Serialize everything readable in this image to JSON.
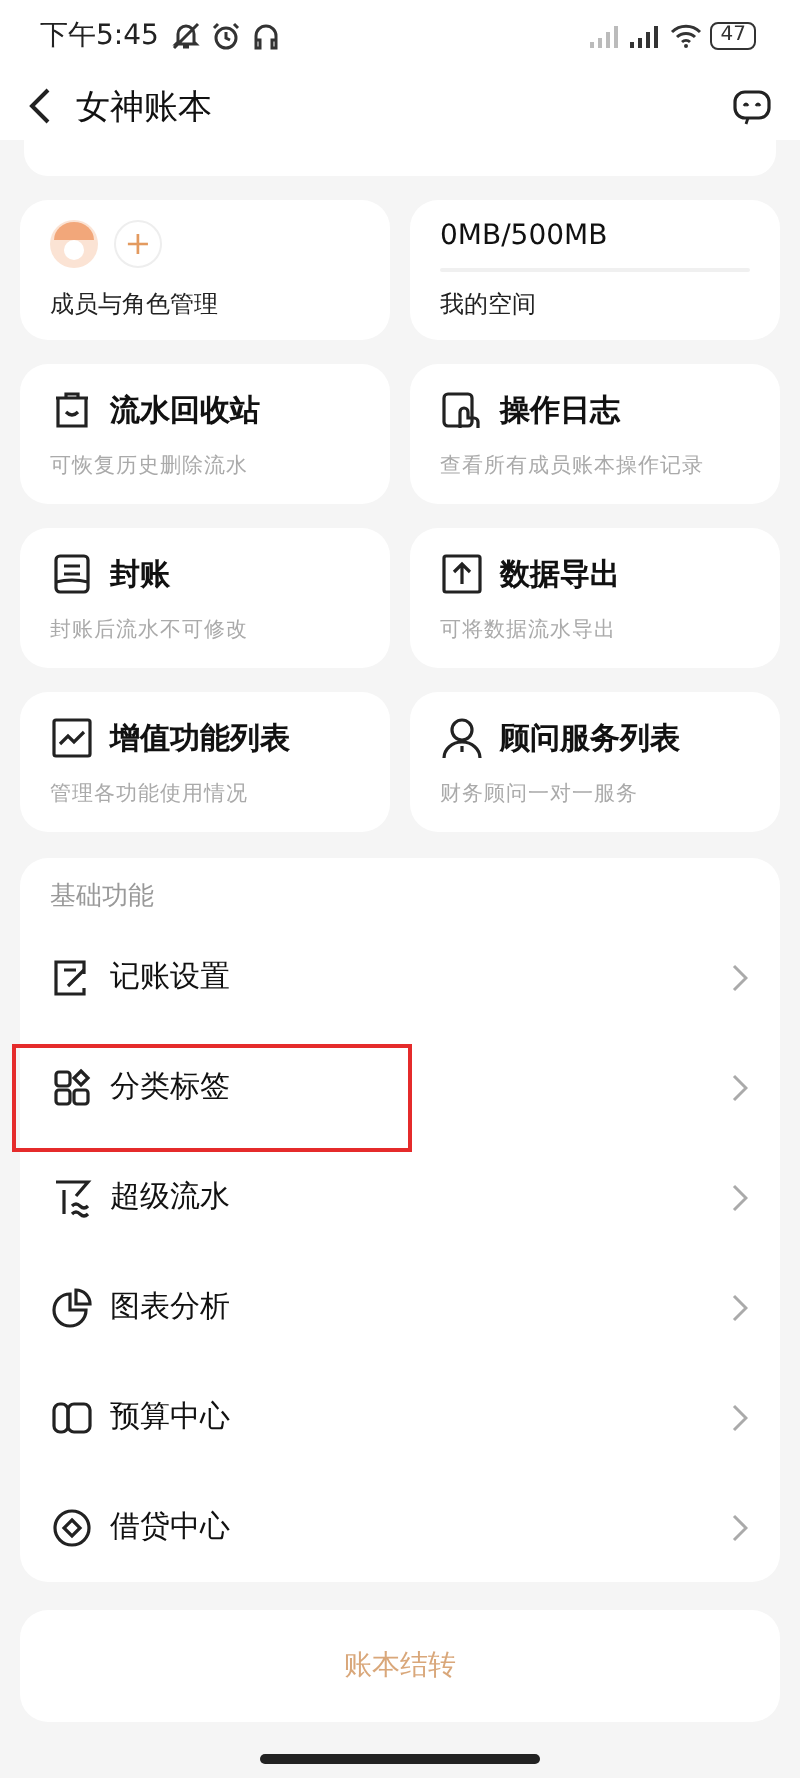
{
  "status_bar": {
    "time": "下午5:45",
    "battery": "47"
  },
  "header": {
    "title": "女神账本"
  },
  "members": {
    "label": "成员与角色管理",
    "add": "+"
  },
  "storage": {
    "usage": "0MB/500MB",
    "level": 0,
    "label": "我的空间"
  },
  "tiles": [
    {
      "title": "流水回收站",
      "subtitle": "可恢复历史删除流水"
    },
    {
      "title": "操作日志",
      "subtitle": "查看所有成员账本操作记录"
    },
    {
      "title": "封账",
      "subtitle": "封账后流水不可修改"
    },
    {
      "title": "数据导出",
      "subtitle": "可将数据流水导出"
    },
    {
      "title": "增值功能列表",
      "subtitle": "管理各功能使用情况"
    },
    {
      "title": "顾问服务列表",
      "subtitle": "财务顾问一对一服务"
    }
  ],
  "basic": {
    "heading": "基础功能",
    "items": [
      {
        "label": "记账设置",
        "highlighted": false
      },
      {
        "label": "分类标签",
        "highlighted": true
      },
      {
        "label": "超级流水",
        "highlighted": false
      },
      {
        "label": "图表分析",
        "highlighted": false
      },
      {
        "label": "预算中心",
        "highlighted": false
      },
      {
        "label": "借贷中心",
        "highlighted": false
      }
    ]
  },
  "transfer_button": "账本结转"
}
